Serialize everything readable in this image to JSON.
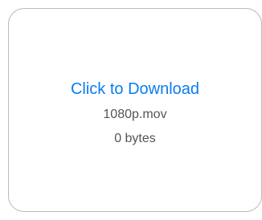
{
  "download_card": {
    "link_label": "Click to Download",
    "file_name": "1080p.mov",
    "file_size": "0 bytes"
  },
  "colors": {
    "link": "#0a7cf2",
    "text": "#555555",
    "border": "#b9b9b9"
  }
}
